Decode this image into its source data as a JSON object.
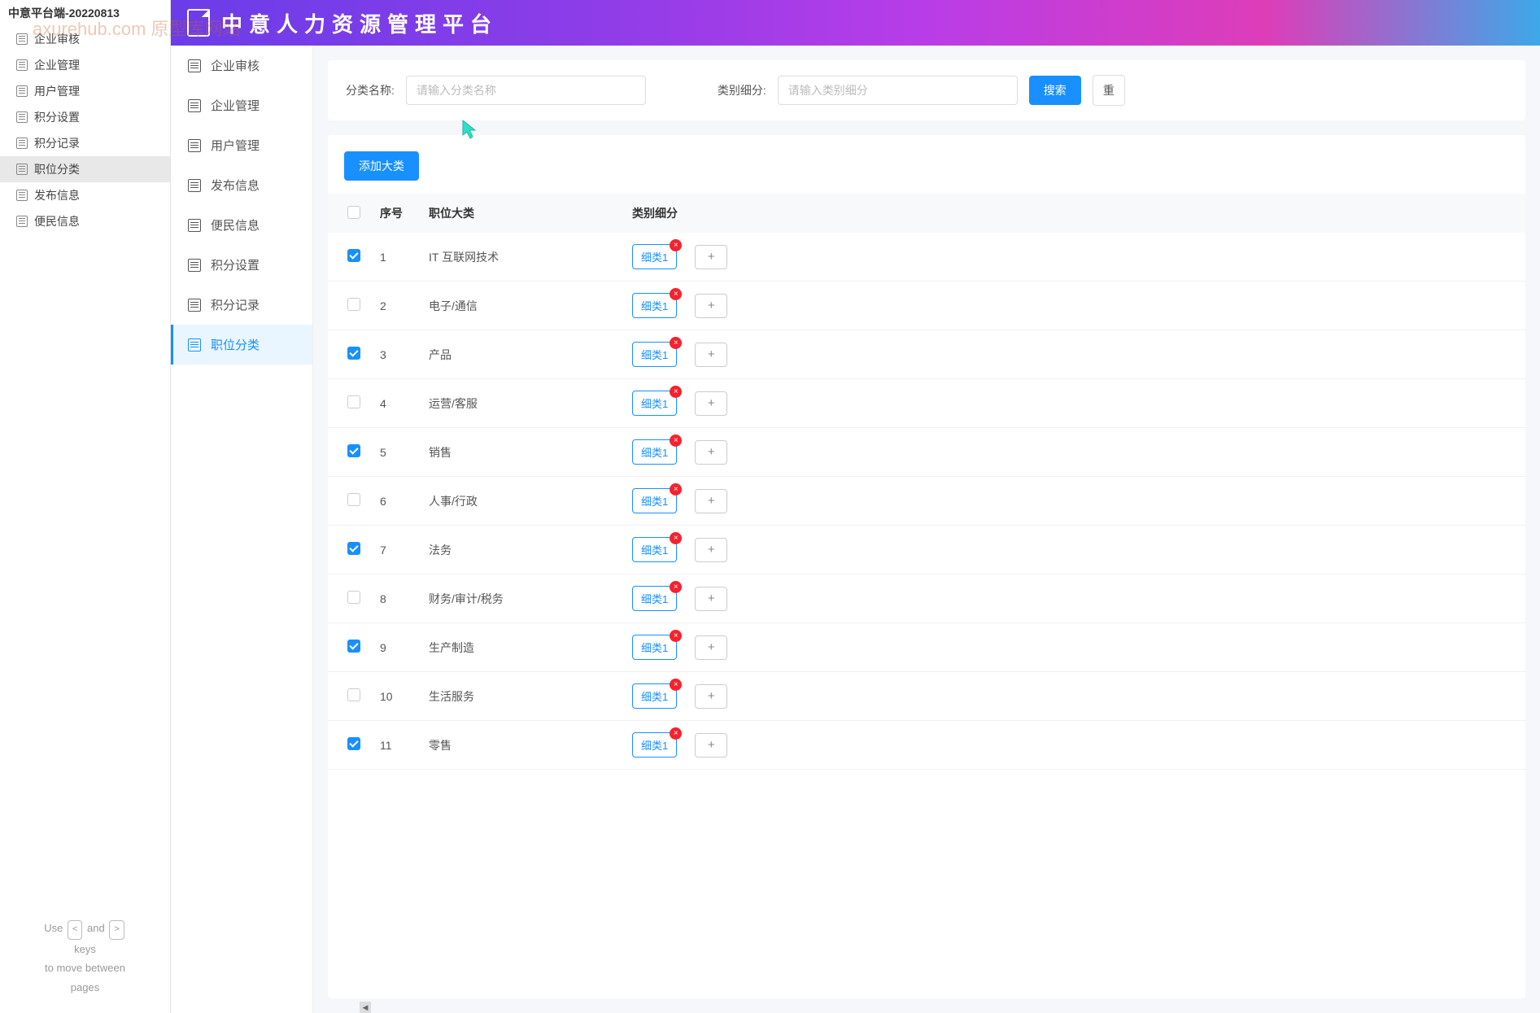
{
  "watermark": "axurehub.com 原型库网站",
  "outline": {
    "title": "中意平台端-20220813",
    "items": [
      {
        "label": "企业审核"
      },
      {
        "label": "企业管理"
      },
      {
        "label": "用户管理"
      },
      {
        "label": "积分设置"
      },
      {
        "label": "积分记录"
      },
      {
        "label": "职位分类",
        "active": true
      },
      {
        "label": "发布信息"
      },
      {
        "label": "便民信息"
      }
    ],
    "help": {
      "line1_a": "Use",
      "key_left": "<",
      "line1_b": "and",
      "key_right": ">",
      "line2": "keys",
      "line3": "to move between",
      "line4": "pages"
    }
  },
  "header": {
    "title": "中意人力资源管理平台"
  },
  "sidenav": {
    "items": [
      {
        "label": "企业审核"
      },
      {
        "label": "企业管理"
      },
      {
        "label": "用户管理"
      },
      {
        "label": "发布信息"
      },
      {
        "label": "便民信息"
      },
      {
        "label": "积分设置"
      },
      {
        "label": "积分记录"
      },
      {
        "label": "职位分类",
        "active": true
      }
    ]
  },
  "search": {
    "label1": "分类名称:",
    "placeholder1": "请输入分类名称",
    "label2": "类别细分:",
    "placeholder2": "请输入类别细分",
    "btn_search": "搜索",
    "btn_reset": "重"
  },
  "table": {
    "add_btn": "添加大类",
    "headers": {
      "seq": "序号",
      "category": "职位大类",
      "sub": "类别细分"
    },
    "tag_label": "细类1",
    "add_icon": "+",
    "close_icon": "×",
    "rows": [
      {
        "seq": "1",
        "category": "IT 互联网技术",
        "checked": true
      },
      {
        "seq": "2",
        "category": "电子/通信",
        "checked": false
      },
      {
        "seq": "3",
        "category": "产品",
        "checked": true
      },
      {
        "seq": "4",
        "category": "运营/客服",
        "checked": false
      },
      {
        "seq": "5",
        "category": "销售",
        "checked": true
      },
      {
        "seq": "6",
        "category": "人事/行政",
        "checked": false
      },
      {
        "seq": "7",
        "category": "法务",
        "checked": true
      },
      {
        "seq": "8",
        "category": "财务/审计/税务",
        "checked": false
      },
      {
        "seq": "9",
        "category": "生产制造",
        "checked": true
      },
      {
        "seq": "10",
        "category": "生活服务",
        "checked": false
      },
      {
        "seq": "11",
        "category": "零售",
        "checked": true
      }
    ]
  }
}
